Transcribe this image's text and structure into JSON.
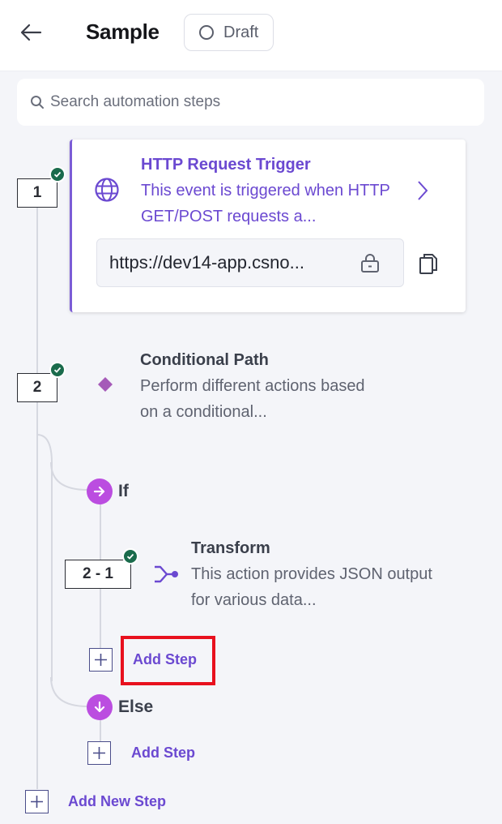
{
  "header": {
    "title": "Sample",
    "status_label": "Draft"
  },
  "search": {
    "placeholder": "Search automation steps"
  },
  "steps": [
    {
      "number": "1",
      "title": "HTTP Request Trigger",
      "description": "This event is triggered when HTTP GET/POST requests a...",
      "url": "https://dev14-app.csno...",
      "completed": true
    },
    {
      "number": "2",
      "title": "Conditional Path",
      "description": "Perform different actions based on a conditional...",
      "completed": true
    }
  ],
  "branches": {
    "if_label": "If",
    "else_label": "Else",
    "if_step": {
      "number": "2 - 1",
      "title": "Transform",
      "description": "This action provides JSON output for various data...",
      "completed": true
    },
    "if_add_step": "Add Step",
    "else_add_step": "Add Step"
  },
  "add_new_step": "Add New Step",
  "colors": {
    "accent": "#6b49d1",
    "branch": "#bb4de0",
    "check": "#1a6b4c",
    "highlight": "#e8101e",
    "diamond": "#a55ab8"
  },
  "icons": [
    "back-arrow-icon",
    "draft-circle-icon",
    "search-icon",
    "check-icon",
    "globe-icon",
    "chevron-right-icon",
    "lock-icon",
    "copy-icon",
    "diamond-icon",
    "arrow-right-icon",
    "arrow-down-icon",
    "transform-icon",
    "plus-icon"
  ]
}
